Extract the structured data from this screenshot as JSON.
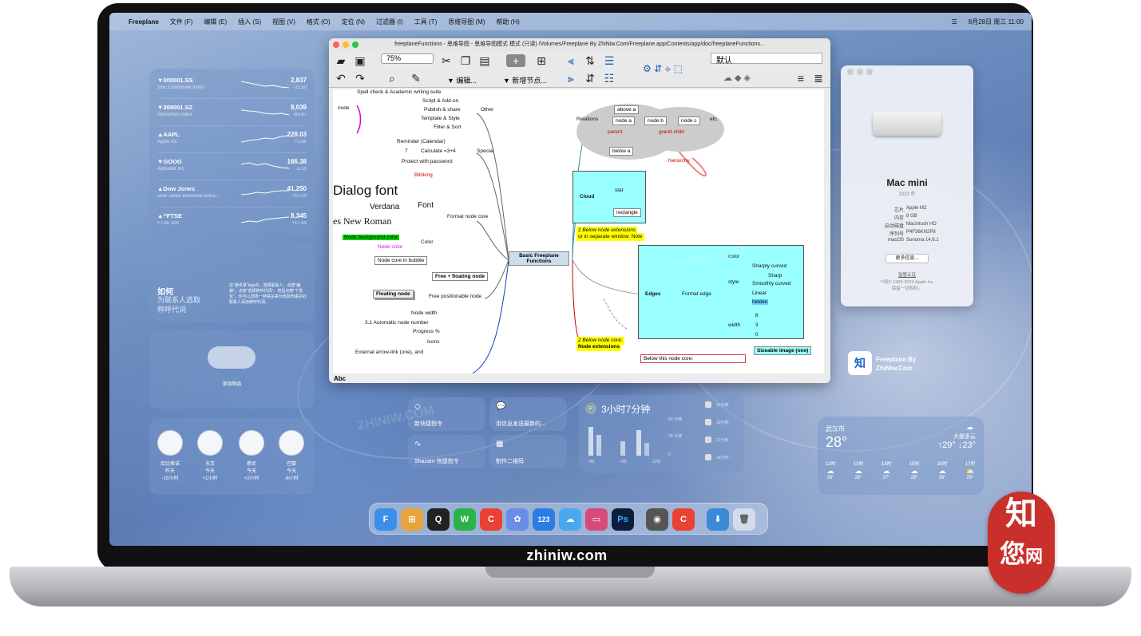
{
  "menubar": {
    "apple": "",
    "app": "Freeplane",
    "items": [
      "文件 (F)",
      "编辑 (E)",
      "插入 (S)",
      "视图 (V)",
      "格式 (O)",
      "定位 (N)",
      "过滤器 (I)",
      "工具 (T)",
      "思维导图 (M)",
      "帮助 (H)"
    ],
    "datetime": "8月28日 周三  11:00"
  },
  "stocks": [
    {
      "name": "▼000001.SS",
      "desc": "SSE Composite Index",
      "value": "2,837",
      "change": "-11.50"
    },
    {
      "name": "▼399001.SZ",
      "desc": "Shenzhen Index",
      "value": "8,039",
      "change": "-64.67"
    },
    {
      "name": "▲AAPL",
      "desc": "Apple Inc.",
      "value": "228.03",
      "change": "+2.85"
    },
    {
      "name": "▼GOOG",
      "desc": "Alphabet Inc.",
      "value": "166.38",
      "change": "-1.55"
    },
    {
      "name": "▲Dow Jones",
      "desc": "Dow Jones Industrial Avera...",
      "value": "41,250",
      "change": "+10.00"
    },
    {
      "name": "▲^FTSE",
      "desc": "FTSE 100",
      "value": "8,345",
      "change": "+17.69"
    }
  ],
  "contacts": {
    "title": "如何",
    "line2": "为联系人选取",
    "line3": "称呼代词",
    "desc": "在\"通讯录\"App中，选择联系人，点按\"编辑\"，点按\"选择称呼代词\"，然后点按\"个性化\"。你可以选择一种语言来为该其他语言的联系人添加称呼代词。"
  },
  "items_widget": {
    "label": "添加物品"
  },
  "clocks": [
    {
      "city": "库比蒂诺",
      "day": "昨天",
      "offset": "-15小时"
    },
    {
      "city": "东京",
      "day": "今天",
      "offset": "+1小时"
    },
    {
      "city": "悉尼",
      "day": "今天",
      "offset": "+2小时"
    },
    {
      "city": "巴黎",
      "day": "今天",
      "offset": "-6小时"
    }
  ],
  "freeplane": {
    "title": "freeplaneFunctions - 思维导图 - 思维导图模式 模式 (只读) /Volumes/Freeplane By ZhiNiw.Com/Freeplane.app/Contents/app/doc/freeplaneFunctions...",
    "zoom": "75%",
    "edit_label": "▼ 编辑...",
    "new_node_label": "▼ 新增节点...",
    "style_value": "默认",
    "status": "Abc",
    "nodes": {
      "spell": "Spell check & Academic writing suite",
      "node": "node",
      "script": "Script & Add-on",
      "publish": "Publish & share",
      "template": "Template & Style",
      "filter": "Filter & Sort",
      "other": "Other",
      "reminder": "Reminder (Calendar)",
      "calculate": "Calculate =3+4",
      "seven": "7",
      "protect": "Protect with password",
      "special": "Special",
      "blinking": "Blinking",
      "dialog": "Dialog font",
      "verdana": "Verdana",
      "font": "Font",
      "tnr": "es New Roman",
      "format_core": "Format node core",
      "bg": "Node background color",
      "ncolor": "Node color",
      "color": "Color",
      "bubble": "Node core in bubble",
      "free": "Free + floating node",
      "floating": "Floating node",
      "positionable": "Free positionable node",
      "width": "Node width",
      "auto": "3.1 Automatic node number",
      "progress": "Progress %",
      "icons": "Icons",
      "arrow": "External arrow-link (one), and",
      "center": "Basic Freeplane Functions",
      "relations": "Relations",
      "above": "above a",
      "nodea": "node a",
      "nodeb": "node b",
      "nodec": "node c",
      "etc": "etc.",
      "parent": "parent",
      "grandchild": "grand child",
      "below": "below a",
      "hierarchy": "hierarchy",
      "cloud": "Cloud",
      "star": "star",
      "rectangle": "rectangle",
      "below_ext": "1 Below node extensions",
      "separate": "or in separate window: Note",
      "edges": "Edges",
      "format_edge": "Format edge",
      "ecolor": "color",
      "estyle": "style",
      "sharply": "Sharply curved",
      "sharp": "Sharp",
      "smoothly": "Smoothly curved",
      "linear": "Linear",
      "hidden": "hidden",
      "ewidth": "width",
      "w8": "8",
      "w3": "3",
      "w0": "0",
      "below2": "2 Below node core:",
      "node_ext": "Node extensions",
      "below_core": "Below this node core:",
      "sizeable": "Sizeable image (one)"
    }
  },
  "about": {
    "model": "Mac mini",
    "year": "2023 年",
    "specs": [
      [
        "芯片",
        "Apple M2"
      ],
      [
        "内存",
        "8 GB"
      ],
      [
        "启动磁盘",
        "Macintosh HD"
      ],
      [
        "序列号",
        "P4F36KN2P8"
      ],
      [
        "macOS",
        "Sonoma 14.6.1"
      ]
    ],
    "more": "更多信息...",
    "regulatory": "监管认证",
    "copyright": "™和© 1983-2024 Apple Inc.",
    "rights": "保留一切权利。"
  },
  "desktop_icon": {
    "label1": "Freeplane By",
    "label2": "ZhiNiw.Com"
  },
  "shortcuts": [
    {
      "label": "新快捷指令"
    },
    {
      "label": "用信息发送最新的..."
    },
    {
      "label": "Shazam 快捷指令"
    },
    {
      "label": "制作二维码"
    }
  ],
  "screentime": {
    "total": "3小时7分钟",
    "y60": "60 分钟",
    "y30": "30 分钟",
    "y0": "0",
    "x0": "0时",
    "x6": "6时",
    "x12": "12时",
    "apps": [
      "41分钟",
      "30分钟",
      "21分钟",
      "19分钟"
    ]
  },
  "weather": {
    "city": "武汉市",
    "temp": "28°",
    "cond": "大部多云",
    "hilo": "↑29° ↓23°",
    "hours": [
      {
        "t": "12时",
        "v": "28°"
      },
      {
        "t": "13时",
        "v": "28°"
      },
      {
        "t": "14时",
        "v": "27°"
      },
      {
        "t": "15时",
        "v": "28°"
      },
      {
        "t": "16时",
        "v": "28°"
      },
      {
        "t": "17时",
        "v": "29°"
      }
    ]
  },
  "watermark": "ZHINIW.COM",
  "brand": "zhiniw.com",
  "seal": {
    "c1": "知",
    "c2": "网",
    "c3": "您"
  },
  "dock": [
    "F",
    "⊞",
    "Q",
    "W",
    "C",
    "✿",
    "123",
    "☁",
    "▭",
    "Ps",
    "◉",
    "C",
    "⬇",
    "🗑"
  ]
}
